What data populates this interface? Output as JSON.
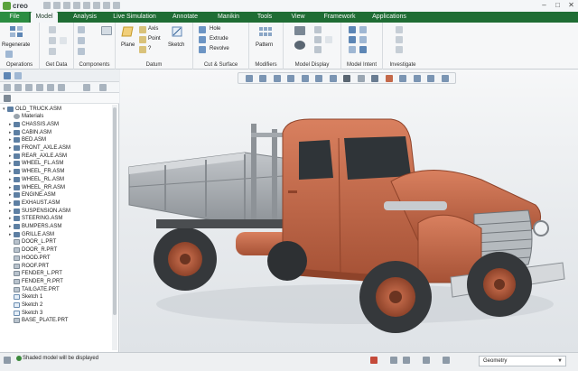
{
  "app": {
    "logo_text": "creo"
  },
  "tabs": [
    {
      "id": "file",
      "label": "File"
    },
    {
      "id": "model",
      "label": "Model"
    },
    {
      "id": "analysis",
      "label": "Analysis"
    },
    {
      "id": "live_simulation",
      "label": "Live Simulation"
    },
    {
      "id": "annotate",
      "label": "Annotate"
    },
    {
      "id": "manikin",
      "label": "Manikin"
    },
    {
      "id": "tools",
      "label": "Tools"
    },
    {
      "id": "view",
      "label": "View"
    },
    {
      "id": "framework",
      "label": "Framework"
    },
    {
      "id": "applications",
      "label": "Applications"
    }
  ],
  "active_tab": "Model",
  "ribbon": {
    "regenerate_label": "Regenerate",
    "groups": {
      "operations": "Operations",
      "get_data": "Get Data",
      "components": "Components",
      "datum": "Datum",
      "cut_surface": "Cut & Surface",
      "modifiers": "Modifiers",
      "model_display": "Model Display",
      "model_intent": "Model Intent",
      "investigate": "Investigate"
    },
    "plane_label": "Plane",
    "axis_label": "Axis",
    "point_label": "Point",
    "sketch_label": "Sketch",
    "hole_label": "Hole",
    "extrude_label": "Extrude",
    "revolve_label": "Revolve",
    "pattern_label": "Pattern",
    "coord_label": "?"
  },
  "model_tree": {
    "items": [
      {
        "label": "OLD_TRUCK.ASM",
        "type": "asm",
        "depth": 0
      },
      {
        "label": "Materials",
        "type": "mat",
        "depth": 1
      },
      {
        "label": "CHASSIS.ASM",
        "type": "asm",
        "depth": 1
      },
      {
        "label": "CABIN.ASM",
        "type": "asm",
        "depth": 1
      },
      {
        "label": "BED.ASM",
        "type": "asm",
        "depth": 1
      },
      {
        "label": "FRONT_AXLE.ASM",
        "type": "asm",
        "depth": 1
      },
      {
        "label": "REAR_AXLE.ASM",
        "type": "asm",
        "depth": 1
      },
      {
        "label": "WHEEL_FL.ASM",
        "type": "asm",
        "depth": 1
      },
      {
        "label": "WHEEL_FR.ASM",
        "type": "asm",
        "depth": 1
      },
      {
        "label": "WHEEL_RL.ASM",
        "type": "asm",
        "depth": 1
      },
      {
        "label": "WHEEL_RR.ASM",
        "type": "asm",
        "depth": 1
      },
      {
        "label": "ENGINE.ASM",
        "type": "asm",
        "depth": 1
      },
      {
        "label": "EXHAUST.ASM",
        "type": "asm",
        "depth": 1
      },
      {
        "label": "SUSPENSION.ASM",
        "type": "asm",
        "depth": 1
      },
      {
        "label": "STEERING.ASM",
        "type": "asm",
        "depth": 1
      },
      {
        "label": "BUMPERS.ASM",
        "type": "asm",
        "depth": 1
      },
      {
        "label": "GRILLE.ASM",
        "type": "asm",
        "depth": 1
      },
      {
        "label": "DOOR_L.PRT",
        "type": "prt",
        "depth": 1
      },
      {
        "label": "DOOR_R.PRT",
        "type": "prt",
        "depth": 1
      },
      {
        "label": "HOOD.PRT",
        "type": "prt",
        "depth": 1
      },
      {
        "label": "ROOF.PRT",
        "type": "prt",
        "depth": 1
      },
      {
        "label": "FENDER_L.PRT",
        "type": "prt",
        "depth": 1
      },
      {
        "label": "FENDER_R.PRT",
        "type": "prt",
        "depth": 1
      },
      {
        "label": "TAILGATE.PRT",
        "type": "prt",
        "depth": 1
      },
      {
        "label": "Sketch 1",
        "type": "sk",
        "depth": 1
      },
      {
        "label": "Sketch 2",
        "type": "sk",
        "depth": 1
      },
      {
        "label": "Sketch 3",
        "type": "sk",
        "depth": 1
      },
      {
        "label": "BASE_PLATE.PRT",
        "type": "prt",
        "depth": 1
      }
    ]
  },
  "status": {
    "message": "Shaded model will be displayed",
    "filter_value": "Geometry"
  },
  "colors": {
    "tab_bar": "#1f6d34",
    "file_tab": "#2b8d41",
    "truck_paint": "#c4694a",
    "bed_metal": "#a7acb1",
    "tire": "#3a3d40"
  },
  "icons": {
    "regenerate": "regenerate-icon",
    "plane": "datum-plane-icon",
    "sketch": "sketch-icon",
    "pattern": "pattern-icon"
  }
}
